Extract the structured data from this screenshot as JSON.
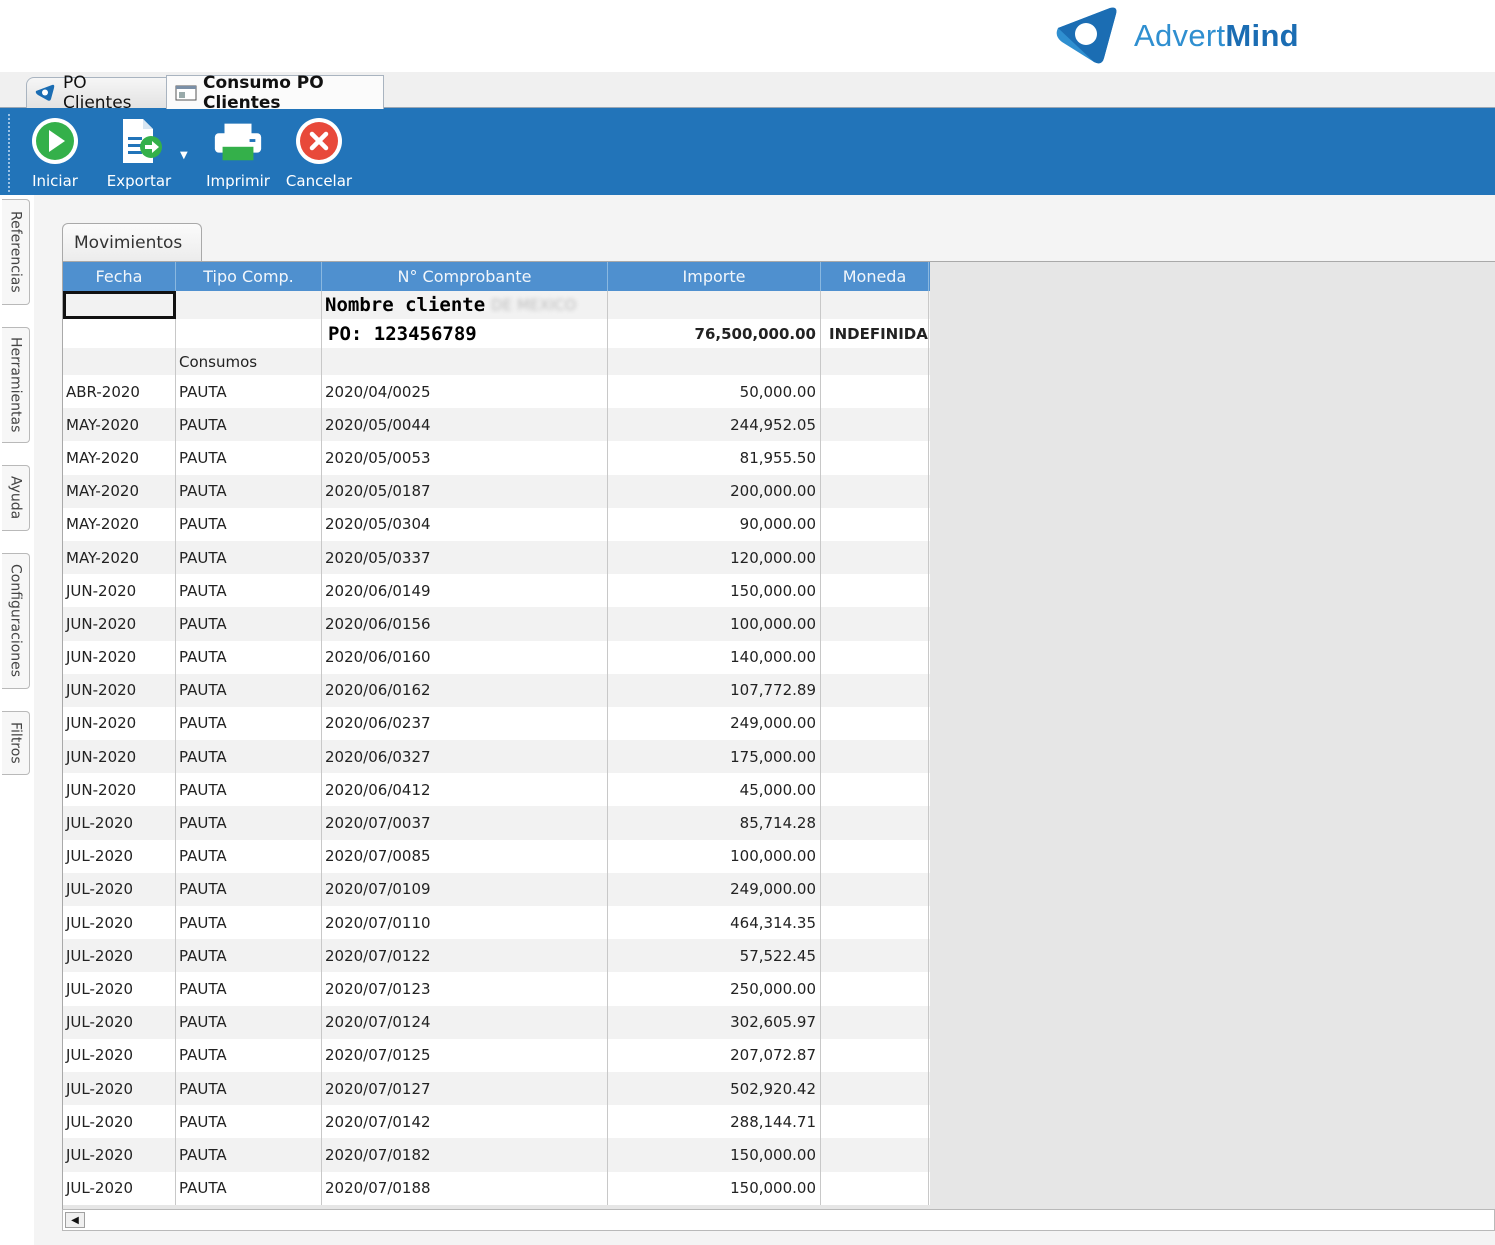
{
  "brand": {
    "name_light": "Advert",
    "name_bold": "Mind",
    "colors": {
      "primary": "#2274b9",
      "logo": "#2f8fd0"
    }
  },
  "doc_tabs": [
    {
      "label": "PO Clientes",
      "icon": "advertmind-logo-icon",
      "active": false
    },
    {
      "label": "Consumo PO Clientes",
      "icon": "window-icon",
      "active": true
    }
  ],
  "toolbar": {
    "iniciar": "Iniciar",
    "exportar": "Exportar",
    "imprimir": "Imprimir",
    "cancelar": "Cancelar"
  },
  "side_tabs": [
    "Referencias",
    "Herramientas",
    "Ayuda",
    "Configuraciones",
    "Filtros"
  ],
  "grid": {
    "tab_label": "Movimientos",
    "columns": [
      "Fecha",
      "Tipo Comp.",
      "N° Comprobante",
      "Importe",
      "Moneda"
    ],
    "client_name_label": "Nombre cliente",
    "client_name_blurred": "DE MEXICO",
    "po_label": "PO: 123456789",
    "po_amount": "76,500,000.00",
    "po_currency": "INDEFINIDA",
    "section_label": "Consumos",
    "rows": [
      {
        "fecha": "ABR-2020",
        "tipo": "PAUTA",
        "num": "2020/04/0025",
        "importe": "50,000.00"
      },
      {
        "fecha": "MAY-2020",
        "tipo": "PAUTA",
        "num": "2020/05/0044",
        "importe": "244,952.05"
      },
      {
        "fecha": "MAY-2020",
        "tipo": "PAUTA",
        "num": "2020/05/0053",
        "importe": "81,955.50"
      },
      {
        "fecha": "MAY-2020",
        "tipo": "PAUTA",
        "num": "2020/05/0187",
        "importe": "200,000.00"
      },
      {
        "fecha": "MAY-2020",
        "tipo": "PAUTA",
        "num": "2020/05/0304",
        "importe": "90,000.00"
      },
      {
        "fecha": "MAY-2020",
        "tipo": "PAUTA",
        "num": "2020/05/0337",
        "importe": "120,000.00"
      },
      {
        "fecha": "JUN-2020",
        "tipo": "PAUTA",
        "num": "2020/06/0149",
        "importe": "150,000.00"
      },
      {
        "fecha": "JUN-2020",
        "tipo": "PAUTA",
        "num": "2020/06/0156",
        "importe": "100,000.00"
      },
      {
        "fecha": "JUN-2020",
        "tipo": "PAUTA",
        "num": "2020/06/0160",
        "importe": "140,000.00"
      },
      {
        "fecha": "JUN-2020",
        "tipo": "PAUTA",
        "num": "2020/06/0162",
        "importe": "107,772.89"
      },
      {
        "fecha": "JUN-2020",
        "tipo": "PAUTA",
        "num": "2020/06/0237",
        "importe": "249,000.00"
      },
      {
        "fecha": "JUN-2020",
        "tipo": "PAUTA",
        "num": "2020/06/0327",
        "importe": "175,000.00"
      },
      {
        "fecha": "JUN-2020",
        "tipo": "PAUTA",
        "num": "2020/06/0412",
        "importe": "45,000.00"
      },
      {
        "fecha": "JUL-2020",
        "tipo": "PAUTA",
        "num": "2020/07/0037",
        "importe": "85,714.28"
      },
      {
        "fecha": "JUL-2020",
        "tipo": "PAUTA",
        "num": "2020/07/0085",
        "importe": "100,000.00"
      },
      {
        "fecha": "JUL-2020",
        "tipo": "PAUTA",
        "num": "2020/07/0109",
        "importe": "249,000.00"
      },
      {
        "fecha": "JUL-2020",
        "tipo": "PAUTA",
        "num": "2020/07/0110",
        "importe": "464,314.35"
      },
      {
        "fecha": "JUL-2020",
        "tipo": "PAUTA",
        "num": "2020/07/0122",
        "importe": "57,522.45"
      },
      {
        "fecha": "JUL-2020",
        "tipo": "PAUTA",
        "num": "2020/07/0123",
        "importe": "250,000.00"
      },
      {
        "fecha": "JUL-2020",
        "tipo": "PAUTA",
        "num": "2020/07/0124",
        "importe": "302,605.97"
      },
      {
        "fecha": "JUL-2020",
        "tipo": "PAUTA",
        "num": "2020/07/0125",
        "importe": "207,072.87"
      },
      {
        "fecha": "JUL-2020",
        "tipo": "PAUTA",
        "num": "2020/07/0127",
        "importe": "502,920.42"
      },
      {
        "fecha": "JUL-2020",
        "tipo": "PAUTA",
        "num": "2020/07/0142",
        "importe": "288,144.71"
      },
      {
        "fecha": "JUL-2020",
        "tipo": "PAUTA",
        "num": "2020/07/0182",
        "importe": "150,000.00"
      },
      {
        "fecha": "JUL-2020",
        "tipo": "PAUTA",
        "num": "2020/07/0188",
        "importe": "150,000.00"
      }
    ]
  }
}
